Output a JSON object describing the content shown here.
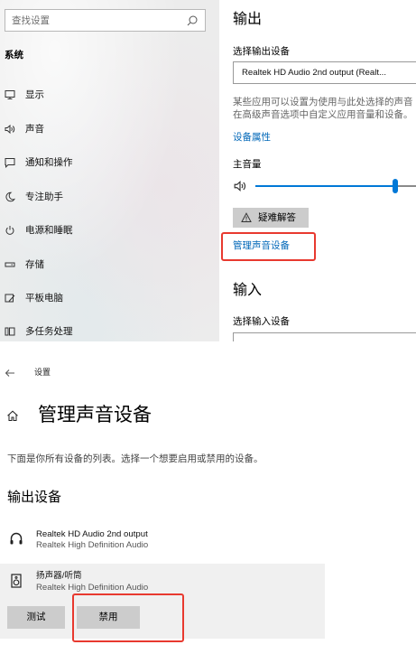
{
  "top": {
    "search": {
      "placeholder": "查找设置",
      "icon": "search-icon"
    },
    "sidebar": {
      "heading": "系统",
      "items": [
        {
          "label": "显示",
          "icon": "monitor-icon"
        },
        {
          "label": "声音",
          "icon": "speaker-icon"
        },
        {
          "label": "通知和操作",
          "icon": "notification-icon"
        },
        {
          "label": "专注助手",
          "icon": "moon-icon"
        },
        {
          "label": "电源和睡眠",
          "icon": "power-icon"
        },
        {
          "label": "存储",
          "icon": "storage-icon"
        },
        {
          "label": "平板电脑",
          "icon": "tablet-icon"
        },
        {
          "label": "多任务处理",
          "icon": "multitask-icon"
        }
      ]
    },
    "output": {
      "heading": "输出",
      "select_label": "选择输出设备",
      "selected_device": "Realtek HD Audio 2nd output (Realt...",
      "note_line1": "某些应用可以设置为使用与此处选择的声音",
      "note_line2": "在高级声音选项中自定义应用音量和设备。",
      "device_properties_link": "设备属性",
      "master_volume_label": "主音量",
      "master_volume_level": 0.87,
      "troubleshoot_label": "疑难解答",
      "troubleshoot_icon": "warning-icon",
      "manage_devices_link": "管理声音设备"
    },
    "input": {
      "heading": "输入",
      "select_label": "选择输入设备"
    }
  },
  "bottom": {
    "back_label": "设置",
    "page_title": "管理声音设备",
    "description": "下面是你所有设备的列表。选择一个想要启用或禁用的设备。",
    "section_heading": "输出设备",
    "devices": [
      {
        "name": "Realtek HD Audio 2nd output",
        "driver": "Realtek High Definition Audio",
        "icon": "headphones-icon",
        "selected": false
      },
      {
        "name": "扬声器/听筒",
        "driver": "Realtek High Definition Audio",
        "icon": "speaker-device-icon",
        "selected": true
      }
    ],
    "test_button": "测试",
    "disable_button": "禁用"
  },
  "colors": {
    "accent": "#0078d7",
    "link": "#0067b8",
    "highlight": "#e8392f",
    "button": "#cccccc"
  }
}
